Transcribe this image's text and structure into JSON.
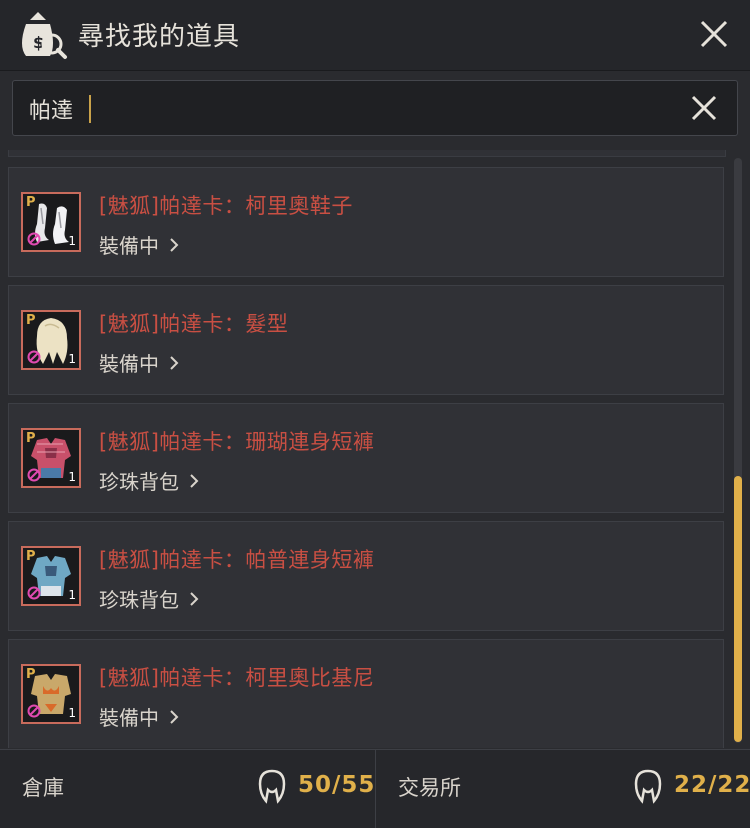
{
  "header": {
    "title": "尋找我的道具",
    "icon": "bag-search-icon"
  },
  "search": {
    "value": "帕達",
    "placeholder": ""
  },
  "items": [
    {
      "name": "[魅狐]帕達卡：柯里奧鞋子",
      "location": "裝備中",
      "count": "1",
      "icon": "shoes-icon"
    },
    {
      "name": "[魅狐]帕達卡：髮型",
      "location": "裝備中",
      "count": "1",
      "icon": "hair-icon"
    },
    {
      "name": "[魅狐]帕達卡：珊瑚連身短褲",
      "location": "珍珠背包",
      "count": "1",
      "icon": "coral-outfit-icon"
    },
    {
      "name": "[魅狐]帕達卡：帕普連身短褲",
      "location": "珍珠背包",
      "count": "1",
      "icon": "papu-outfit-icon"
    },
    {
      "name": "[魅狐]帕達卡：柯里奧比基尼",
      "location": "裝備中",
      "count": "1",
      "icon": "bikini-icon"
    }
  ],
  "item_badge": "P",
  "footer": {
    "warehouse_label": "倉庫",
    "warehouse_value": "50/55",
    "market_label": "交易所",
    "market_value": "22/22"
  },
  "colors": {
    "accent": "#e0b04a",
    "item_name": "#c94f43",
    "background": "#2a2b2f"
  }
}
